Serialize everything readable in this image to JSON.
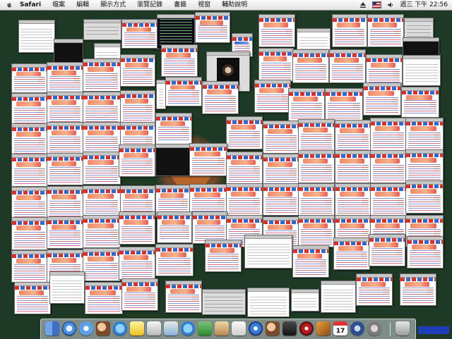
{
  "menubar": {
    "app_name": "Safari",
    "menus": [
      "檔案",
      "編輯",
      "顯示方式",
      "瀏覽記錄",
      "書籤",
      "視窗",
      "輔助說明"
    ],
    "clock": "週三 下午 22:56"
  },
  "desktop": {
    "mode": "Exposé all windows",
    "window_count": 110
  },
  "dock": {
    "calendar_day": "17"
  },
  "colors": {
    "desktop_bg": "#1f3a24",
    "accent": "#d8302c"
  }
}
